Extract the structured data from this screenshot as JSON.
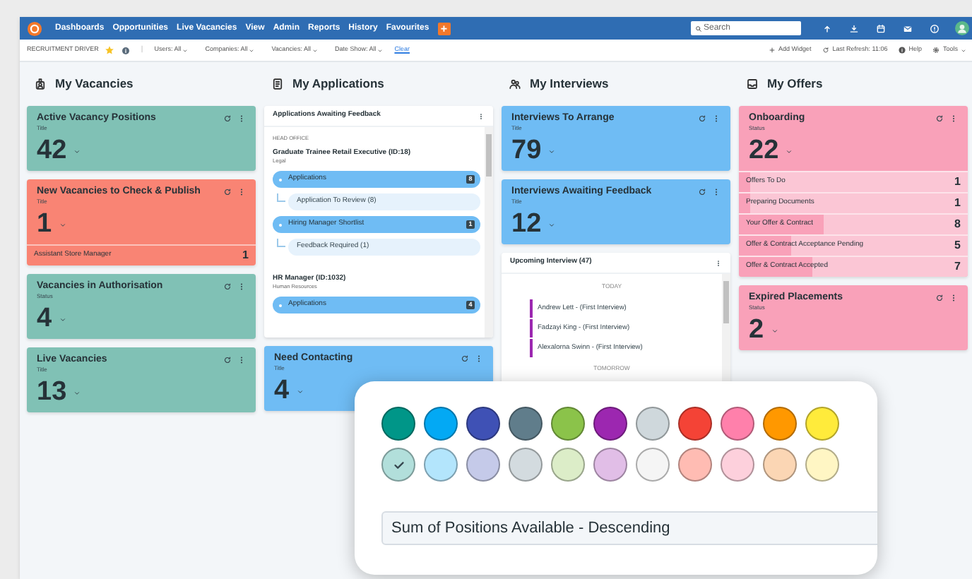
{
  "nav": {
    "items": [
      "Dashboards",
      "Opportunities",
      "Live Vacancies",
      "View",
      "Admin",
      "Reports",
      "History",
      "Favourites"
    ],
    "add_button": "+",
    "search": {
      "placeholder": "Search"
    }
  },
  "filter_bar": {
    "title": "RECRUITMENT DRIVER",
    "separator": "|",
    "filters": [
      "Users: All",
      "Companies: All",
      "Vacancies: All",
      "Date Show: All"
    ],
    "clear": "Clear",
    "actions": [
      {
        "kind": "add",
        "label": "Add Widget"
      },
      {
        "kind": "refresh",
        "label": "Last Refresh: 11:06"
      },
      {
        "kind": "help",
        "label": "Help"
      },
      {
        "kind": "tools",
        "label": "Tools"
      }
    ]
  },
  "columns": [
    {
      "title": "My Vacancies",
      "widgets": [
        {
          "kind": "counter",
          "title": "Active Vacancy Positions",
          "subtitle": "Title",
          "value": "42",
          "color": "#80c1b5"
        },
        {
          "kind": "counter",
          "title": "New Vacancies to Check & Publish",
          "subtitle": "Title",
          "value": "1",
          "color": "#f98474",
          "rows": [
            {
              "label": "Assistant Store Manager",
              "value": "1"
            }
          ]
        },
        {
          "kind": "counter",
          "title": "Vacancies in Authorisation",
          "subtitle": "Status",
          "value": "4",
          "color": "#80c1b5"
        },
        {
          "kind": "counter",
          "title": "Live Vacancies",
          "subtitle": "Title",
          "value": "13",
          "color": "#80c1b5"
        }
      ]
    },
    {
      "title": "My Applications",
      "widgets": [
        {
          "kind": "pipeline",
          "title": "Applications Awaiting Feedback",
          "groups": [
            {
              "label": "HEAD OFFICE",
              "jobs": [
                {
                  "title": "Graduate Trainee Retail Executive (ID:18)",
                  "department": "Legal",
                  "stages": [
                    {
                      "label": "Applications",
                      "count": "8",
                      "children": [
                        {
                          "label": "Application To Review (8)"
                        }
                      ]
                    },
                    {
                      "label": "Hiring Manager Shortlist",
                      "count": "1",
                      "children": [
                        {
                          "label": "Feedback Required (1)"
                        }
                      ]
                    }
                  ]
                },
                {
                  "title": "HR Manager (ID:1032)",
                  "department": "Human Resources",
                  "stages": [
                    {
                      "label": "Applications",
                      "count": "4"
                    }
                  ]
                }
              ]
            }
          ]
        },
        {
          "kind": "counter",
          "title": "Need Contacting",
          "subtitle": "Title",
          "value": "4",
          "color": "#6fbcf4"
        }
      ]
    },
    {
      "title": "My Interviews",
      "widgets": [
        {
          "kind": "counter",
          "title": "Interviews To Arrange",
          "subtitle": "Title",
          "value": "79",
          "color": "#6fbcf4"
        },
        {
          "kind": "counter",
          "title": "Interviews Awaiting Feedback",
          "subtitle": "Title",
          "value": "12",
          "color": "#6fbcf4"
        },
        {
          "kind": "agenda",
          "title": "Upcoming Interview (47)",
          "days": [
            {
              "label": "TODAY",
              "entries": [
                "Andrew Lett - (First Interview)",
                "Fadzayi King - (First Interview)",
                "Alexalorna Swinn - (First Interview)"
              ]
            },
            {
              "label": "TOMORROW"
            }
          ]
        }
      ]
    },
    {
      "title": "My Offers",
      "widgets": [
        {
          "kind": "counter",
          "title": "Onboarding",
          "subtitle": "Status",
          "value": "22",
          "color": "#f9a1b9",
          "rows": [
            {
              "label": "Offers To Do",
              "value": "1",
              "level": 0.05
            },
            {
              "label": "Preparing Documents",
              "value": "1",
              "level": 0.05
            },
            {
              "label": "Your Offer & Contract",
              "value": "8",
              "level": 0.37
            },
            {
              "label": "Offer & Contract Acceptance Pending",
              "value": "5",
              "level": 0.23
            },
            {
              "label": "Offer & Contract Accepted",
              "value": "7",
              "level": 0.32
            }
          ]
        },
        {
          "kind": "counter",
          "title": "Expired Placements",
          "subtitle": "Status",
          "value": "2",
          "color": "#f9a1b9"
        }
      ]
    }
  ],
  "popup": {
    "swatches": [
      {
        "color": "#009688",
        "selected": false
      },
      {
        "color": "#03a9f4",
        "selected": false
      },
      {
        "color": "#3f51b5",
        "selected": false
      },
      {
        "color": "#607d8b",
        "selected": false
      },
      {
        "color": "#8bc34a",
        "selected": false
      },
      {
        "color": "#9c27b0",
        "selected": false
      },
      {
        "color": "#cfd8dc",
        "selected": false
      },
      {
        "color": "#f44336",
        "selected": false
      },
      {
        "color": "#ff80ab",
        "selected": false
      },
      {
        "color": "#ff9800",
        "selected": false
      },
      {
        "color": "#ffeb3b",
        "selected": false
      },
      {
        "color": "#b2dfdb",
        "selected": true
      },
      {
        "color": "#b3e5fc",
        "selected": false
      },
      {
        "color": "#c5cae9",
        "selected": false
      },
      {
        "color": "#d3dbdf",
        "selected": false
      },
      {
        "color": "#dcedc8",
        "selected": false
      },
      {
        "color": "#e1bee7",
        "selected": false
      },
      {
        "color": "#f5f5f5",
        "selected": false
      },
      {
        "color": "#ffbcb3",
        "selected": false
      },
      {
        "color": "#fdd0dc",
        "selected": false
      },
      {
        "color": "#fbd6b4",
        "selected": false
      },
      {
        "color": "#fff6c4",
        "selected": false
      }
    ],
    "sort": {
      "value": "Sum of Positions Available - Descending"
    }
  }
}
